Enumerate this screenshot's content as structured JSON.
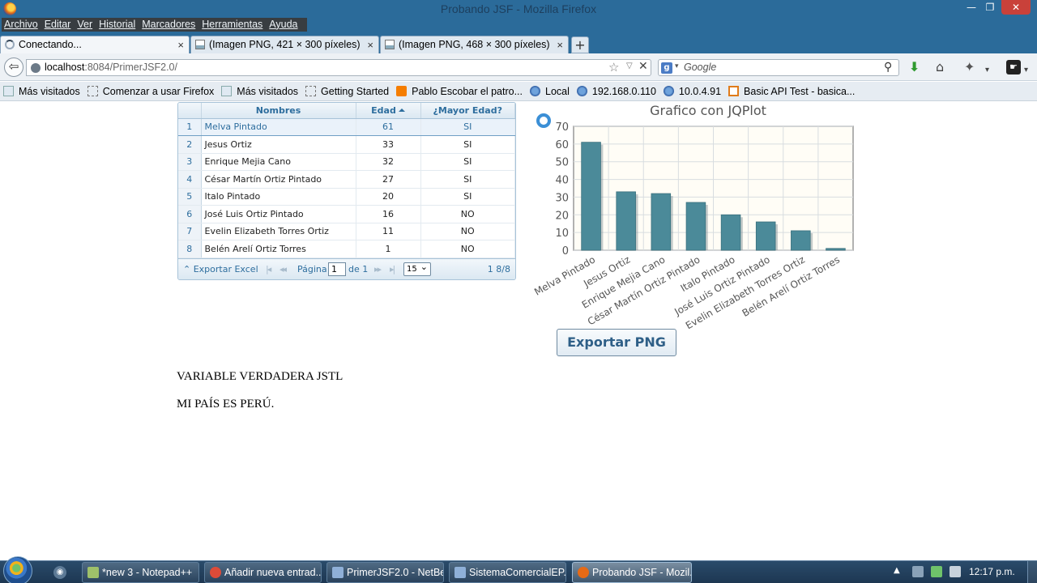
{
  "window": {
    "title": "Probando JSF - Mozilla Firefox",
    "min_glyph": "—",
    "max_glyph": "❐",
    "close_glyph": "✕"
  },
  "menu": [
    "Archivo",
    "Editar",
    "Ver",
    "Historial",
    "Marcadores",
    "Herramientas",
    "Ayuda"
  ],
  "tabs": [
    {
      "label": "Conectando...",
      "active": true
    },
    {
      "label": "(Imagen PNG, 421 × 300 píxeles)",
      "active": false
    },
    {
      "label": "(Imagen PNG, 468 × 300 píxeles)",
      "active": false
    }
  ],
  "tab_close_glyph": "×",
  "new_tab_glyph": "+",
  "nav": {
    "back_glyph": "⇦",
    "url_host": "localhost",
    "url_rest": ":8084/PrimerJSF2.0/",
    "search_placeholder": "Google",
    "search_engine_glyph": "g",
    "star_glyph": "☆",
    "drop_glyph": "▽",
    "stop_glyph": "✕",
    "magnifier_glyph": "⚲",
    "download_glyph": "⬇",
    "home_glyph": "⌂",
    "addon_glyph": "✦",
    "ext_glyph": "☛",
    "menu_drop_glyph": "▾"
  },
  "bookmarks": [
    {
      "label": "Más visitados",
      "icon": "page"
    },
    {
      "label": "Comenzar a usar Firefox",
      "icon": "dash"
    },
    {
      "label": "Más visitados",
      "icon": "page"
    },
    {
      "label": "Getting Started",
      "icon": "dash"
    },
    {
      "label": "Pablo Escobar el patro...",
      "icon": "blogger"
    },
    {
      "label": "Local",
      "icon": "net"
    },
    {
      "label": "192.168.0.110",
      "icon": "net"
    },
    {
      "label": "10.0.4.91",
      "icon": "net"
    },
    {
      "label": "Basic API Test - basica...",
      "icon": "api"
    }
  ],
  "table": {
    "headers": {
      "nombres": "Nombres",
      "edad": "Edad",
      "mayor": "¿Mayor Edad?"
    },
    "rows": [
      {
        "idx": "1",
        "nombre": "Melva Pintado",
        "edad": "61",
        "mayor": "SI",
        "selected": true
      },
      {
        "idx": "2",
        "nombre": "Jesus Ortiz",
        "edad": "33",
        "mayor": "SI"
      },
      {
        "idx": "3",
        "nombre": "Enrique Mejia Cano",
        "edad": "32",
        "mayor": "SI"
      },
      {
        "idx": "4",
        "nombre": "César Martín Ortiz Pintado",
        "edad": "27",
        "mayor": "SI"
      },
      {
        "idx": "5",
        "nombre": "Italo Pintado",
        "edad": "20",
        "mayor": "SI"
      },
      {
        "idx": "6",
        "nombre": "José Luis Ortiz Pintado",
        "edad": "16",
        "mayor": "NO"
      },
      {
        "idx": "7",
        "nombre": "Evelin Elizabeth Torres Ortiz",
        "edad": "11",
        "mayor": "NO"
      },
      {
        "idx": "8",
        "nombre": "Belén Arelí Ortiz Torres",
        "edad": "1",
        "mayor": "NO"
      }
    ],
    "pager": {
      "export_label": "⌃ Exportar Excel",
      "first_glyph": "|◂",
      "prev_glyph": "◂◂",
      "page_label": "Página",
      "page_value": "1",
      "of_label": "de 1",
      "next_glyph": "▸▸",
      "last_glyph": "▸|",
      "page_size": "15",
      "count": "1 8/8"
    }
  },
  "chart_data": {
    "type": "bar",
    "title": "Grafico con JQPlot",
    "categories": [
      "Melva Pintado",
      "Jesus Ortiz",
      "Enrique Mejia Cano",
      "César Martín Ortiz Pintado",
      "Italo Pintado",
      "José Luis Ortiz Pintado",
      "Evelin Elizabeth Torres Ortiz",
      "Belén Arelí Ortiz Torres"
    ],
    "values": [
      61,
      33,
      32,
      27,
      20,
      16,
      11,
      1
    ],
    "ylim": [
      0,
      70
    ],
    "yticks": [
      "0",
      "10",
      "20",
      "30",
      "40",
      "50",
      "60",
      "70"
    ],
    "grid": true,
    "colors": {
      "bar": "#4b8a99",
      "grid": "#d8dde0",
      "background": "#fffdf6"
    }
  },
  "export_png_label": "Exportar PNG",
  "page_text": {
    "jstl": "VARIABLE VERDADERA JSTL",
    "pais": "MI PAÍS ES PERÚ."
  },
  "taskbar": {
    "tasks": [
      {
        "label": "*new  3 - Notepad++",
        "color": "#9ec06a",
        "active": false
      },
      {
        "label": "Añadir nueva entrad...",
        "color": "#dd4b39",
        "active": false
      },
      {
        "label": "PrimerJSF2.0 - NetBe...",
        "color": "#8fb0d8",
        "active": false
      },
      {
        "label": "SistemaComercialEP...",
        "color": "#8fb0d8",
        "active": false
      },
      {
        "label": "Probando JSF - Mozil...",
        "color": "#e66a16",
        "active": true
      }
    ],
    "tray_up_glyph": "▲",
    "media_glyph": "◉",
    "clock": "12:17 p.m."
  }
}
